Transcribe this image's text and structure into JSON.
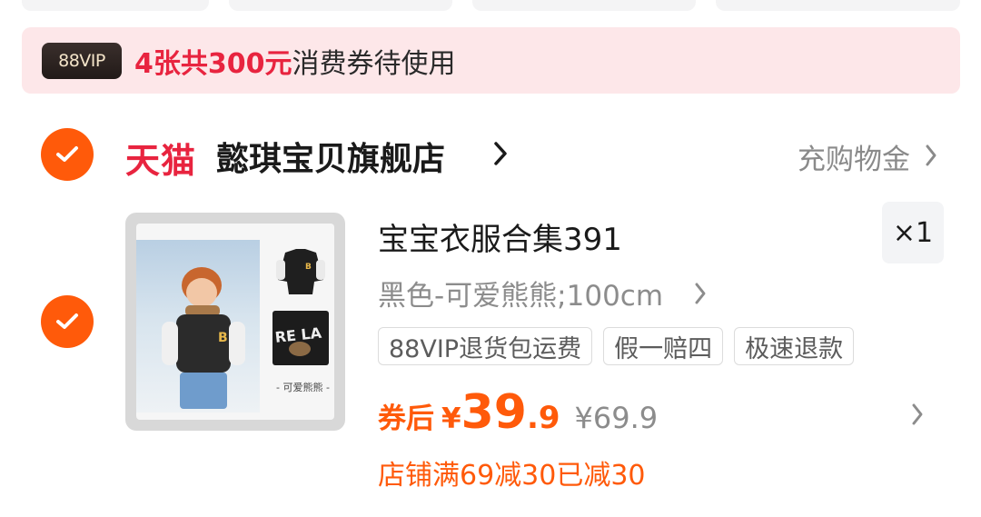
{
  "banner": {
    "badge": "88VIP",
    "highlight": "4张共300元",
    "text": "消费券待使用"
  },
  "store": {
    "platform": "天猫",
    "name": "懿琪宝贝旗舰店",
    "action": "充购物金",
    "checked": true
  },
  "product": {
    "checked": true,
    "title": "宝宝衣服合集391",
    "quantity": "×1",
    "variant": "黑色-可爱熊熊;100cm",
    "tags": [
      "88VIP退货包运费",
      "假一赔四",
      "极速退款"
    ],
    "price_label": "券后",
    "price_currency": "¥",
    "price_int": "39",
    "price_dec": ".9",
    "original_price": "¥69.9",
    "discount_text": "店铺满69减30已减30",
    "image_caption": "- 可爱熊熊 -"
  },
  "colors": {
    "accent_orange": "#ff5a0a",
    "tmall_red": "#e8243f",
    "banner_bg": "#fde7e9"
  },
  "icons": {
    "check": "check-icon",
    "chevron": "chevron-right-icon"
  }
}
